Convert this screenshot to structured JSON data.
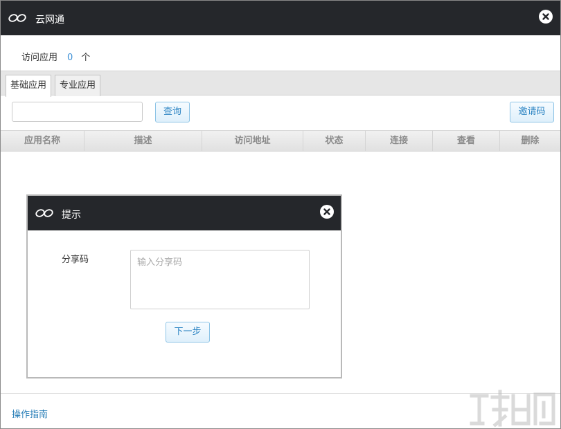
{
  "app": {
    "title": "云网通"
  },
  "summary": {
    "label": "访问应用",
    "count": "0",
    "unit": "个"
  },
  "tabs": [
    {
      "label": "基础应用",
      "active": true
    },
    {
      "label": "专业应用",
      "active": false
    }
  ],
  "toolbar": {
    "search_value": "",
    "query_label": "查询",
    "invite_label": "邀请码"
  },
  "table": {
    "columns": [
      "应用名称",
      "描述",
      "访问地址",
      "状态",
      "连接",
      "查看",
      "删除"
    ],
    "rows": []
  },
  "footer": {
    "guide_link": "操作指南"
  },
  "dialog": {
    "title": "提示",
    "field_label": "分享码",
    "placeholder": "输入分享码",
    "value": "",
    "next_label": "下一步"
  },
  "colors": {
    "titlebar": "#25272b",
    "link": "#2a7fb8",
    "accent": "#3b8fd6",
    "button_border": "#8cc3e6"
  },
  "icons": {
    "logo": "link-chain-icon",
    "close": "close-circle-icon"
  }
}
